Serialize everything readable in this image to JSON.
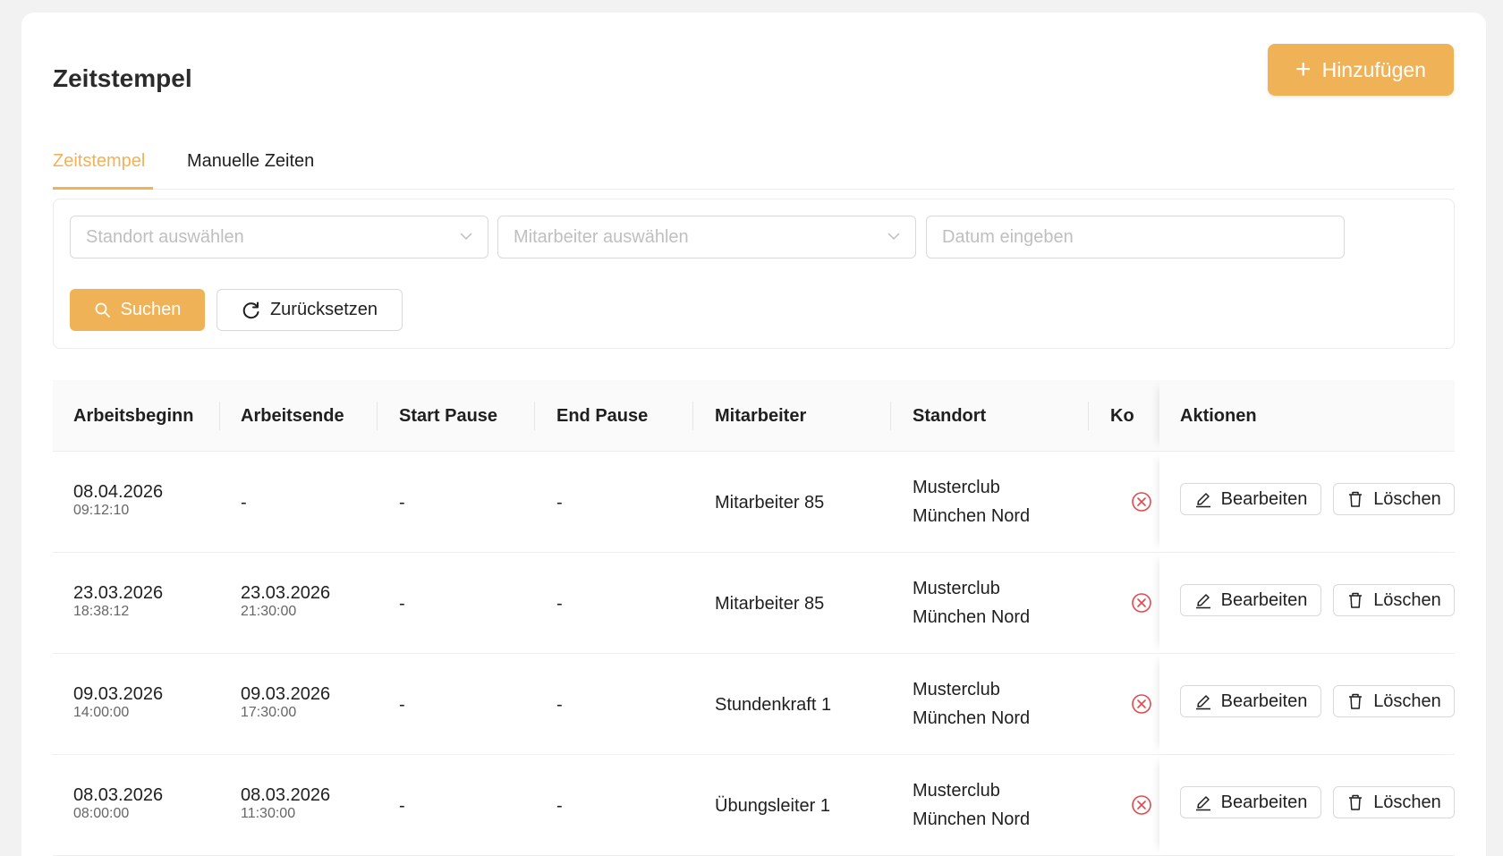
{
  "page": {
    "title": "Zeitstempel",
    "add_label": "Hinzufügen"
  },
  "tabs": [
    {
      "label": "Zeitstempel",
      "active": true
    },
    {
      "label": "Manuelle Zeiten",
      "active": false
    }
  ],
  "filters": {
    "location_placeholder": "Standort auswählen",
    "employee_placeholder": "Mitarbeiter auswählen",
    "date_placeholder": "Datum eingeben",
    "search_label": "Suchen",
    "reset_label": "Zurücksetzen"
  },
  "table": {
    "columns": [
      "Arbeitsbeginn",
      "Arbeitsende",
      "Start Pause",
      "End Pause",
      "Mitarbeiter",
      "Standort",
      "Ko",
      "Aktionen"
    ],
    "edit_label": "Bearbeiten",
    "delete_label": "Löschen",
    "rows": [
      {
        "start_date": "08.04.2026",
        "start_time": "09:12:10",
        "end_date": "-",
        "end_time": "",
        "start_pause": "-",
        "end_pause": "-",
        "employee": "Mitarbeiter 85",
        "location_line1": "Musterclub",
        "location_line2": "München Nord"
      },
      {
        "start_date": "23.03.2026",
        "start_time": "18:38:12",
        "end_date": "23.03.2026",
        "end_time": "21:30:00",
        "start_pause": "-",
        "end_pause": "-",
        "employee": "Mitarbeiter 85",
        "location_line1": "Musterclub",
        "location_line2": "München Nord"
      },
      {
        "start_date": "09.03.2026",
        "start_time": "14:00:00",
        "end_date": "09.03.2026",
        "end_time": "17:30:00",
        "start_pause": "-",
        "end_pause": "-",
        "employee": "Stundenkraft 1",
        "location_line1": "Musterclub",
        "location_line2": "München Nord"
      },
      {
        "start_date": "08.03.2026",
        "start_time": "08:00:00",
        "end_date": "08.03.2026",
        "end_time": "11:30:00",
        "start_pause": "-",
        "end_pause": "-",
        "employee": "Übungsleiter 1",
        "location_line1": "Musterclub",
        "location_line2": "München Nord"
      }
    ]
  },
  "colors": {
    "accent": "#f0b257",
    "danger": "#e5484d"
  },
  "icons": {
    "add": "plus-icon",
    "search": "search-icon",
    "reset": "reload-icon",
    "edit": "edit-icon",
    "delete": "trash-icon",
    "status": "close-circle-icon",
    "dropdown": "chevron-down-icon"
  }
}
